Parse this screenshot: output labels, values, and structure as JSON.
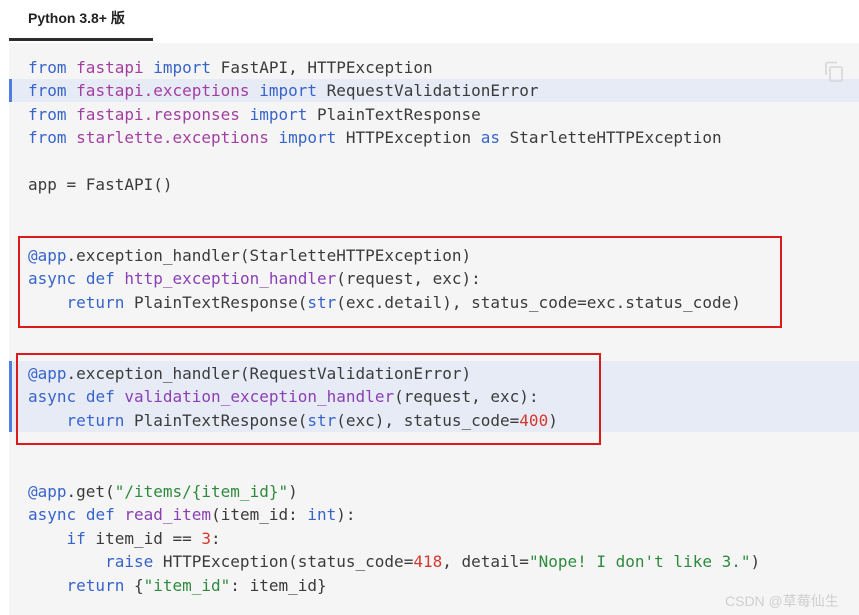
{
  "tab": {
    "label": "Python 3.8+ 版"
  },
  "code": {
    "l1": {
      "a": "from",
      "b": " ",
      "c": "fastapi",
      "d": " ",
      "e": "import",
      "f": " FastAPI, HTTPException"
    },
    "l2": {
      "a": "from",
      "b": " ",
      "c": "fastapi.exceptions",
      "d": " ",
      "e": "import",
      "f": " RequestValidationError"
    },
    "l3": {
      "a": "from",
      "b": " ",
      "c": "fastapi.responses",
      "d": " ",
      "e": "import",
      "f": " PlainTextResponse"
    },
    "l4": {
      "a": "from",
      "b": " ",
      "c": "starlette.exceptions",
      "d": " ",
      "e": "import",
      "f": " HTTPException ",
      "g": "as",
      "h": " StarletteHTTPException"
    },
    "l5": {
      "a": "app = FastAPI()"
    },
    "l6": {
      "a": "@app",
      "b": ".exception_handler(StarletteHTTPException)"
    },
    "l7": {
      "a": "async",
      "b": " ",
      "c": "def",
      "d": " ",
      "e": "http_exception_handler",
      "f": "(request, exc):"
    },
    "l8": {
      "i": "    ",
      "a": "return",
      "b": " PlainTextResponse(",
      "c": "str",
      "d": "(exc.detail), status_code=exc.status_code)"
    },
    "l9": {
      "a": "@app",
      "b": ".exception_handler(RequestValidationError)"
    },
    "l10": {
      "a": "async",
      "b": " ",
      "c": "def",
      "d": " ",
      "e": "validation_exception_handler",
      "f": "(request, exc):"
    },
    "l11": {
      "i": "    ",
      "a": "return",
      "b": " PlainTextResponse(",
      "c": "str",
      "d": "(exc), status_code=",
      "e": "400",
      "f": ")"
    },
    "l12": {
      "a": "@app",
      "b": ".get(",
      "c": "\"/items/{item_id}\"",
      "d": ")"
    },
    "l13": {
      "a": "async",
      "b": " ",
      "c": "def",
      "d": " ",
      "e": "read_item",
      "f": "(item_id: ",
      "g": "int",
      "h": "):"
    },
    "l14": {
      "i": "    ",
      "a": "if",
      "b": " item_id == ",
      "c": "3",
      "d": ":"
    },
    "l15": {
      "i": "        ",
      "a": "raise",
      "b": " HTTPException(status_code=",
      "c": "418",
      "d": ", detail=",
      "e": "\"Nope! I don't like 3.\"",
      "f": ")"
    },
    "l16": {
      "i": "    ",
      "a": "return",
      "b": " {",
      "c": "\"item_id\"",
      "d": ": item_id}"
    }
  },
  "watermark": "CSDN @草莓仙生",
  "colors": {
    "keyword": "#3764cb",
    "module": "#a33ea1",
    "function": "#8b3fb5",
    "number": "#d23a2e",
    "string": "#2e8b3e",
    "highlight_box": "#dd1a1a"
  }
}
